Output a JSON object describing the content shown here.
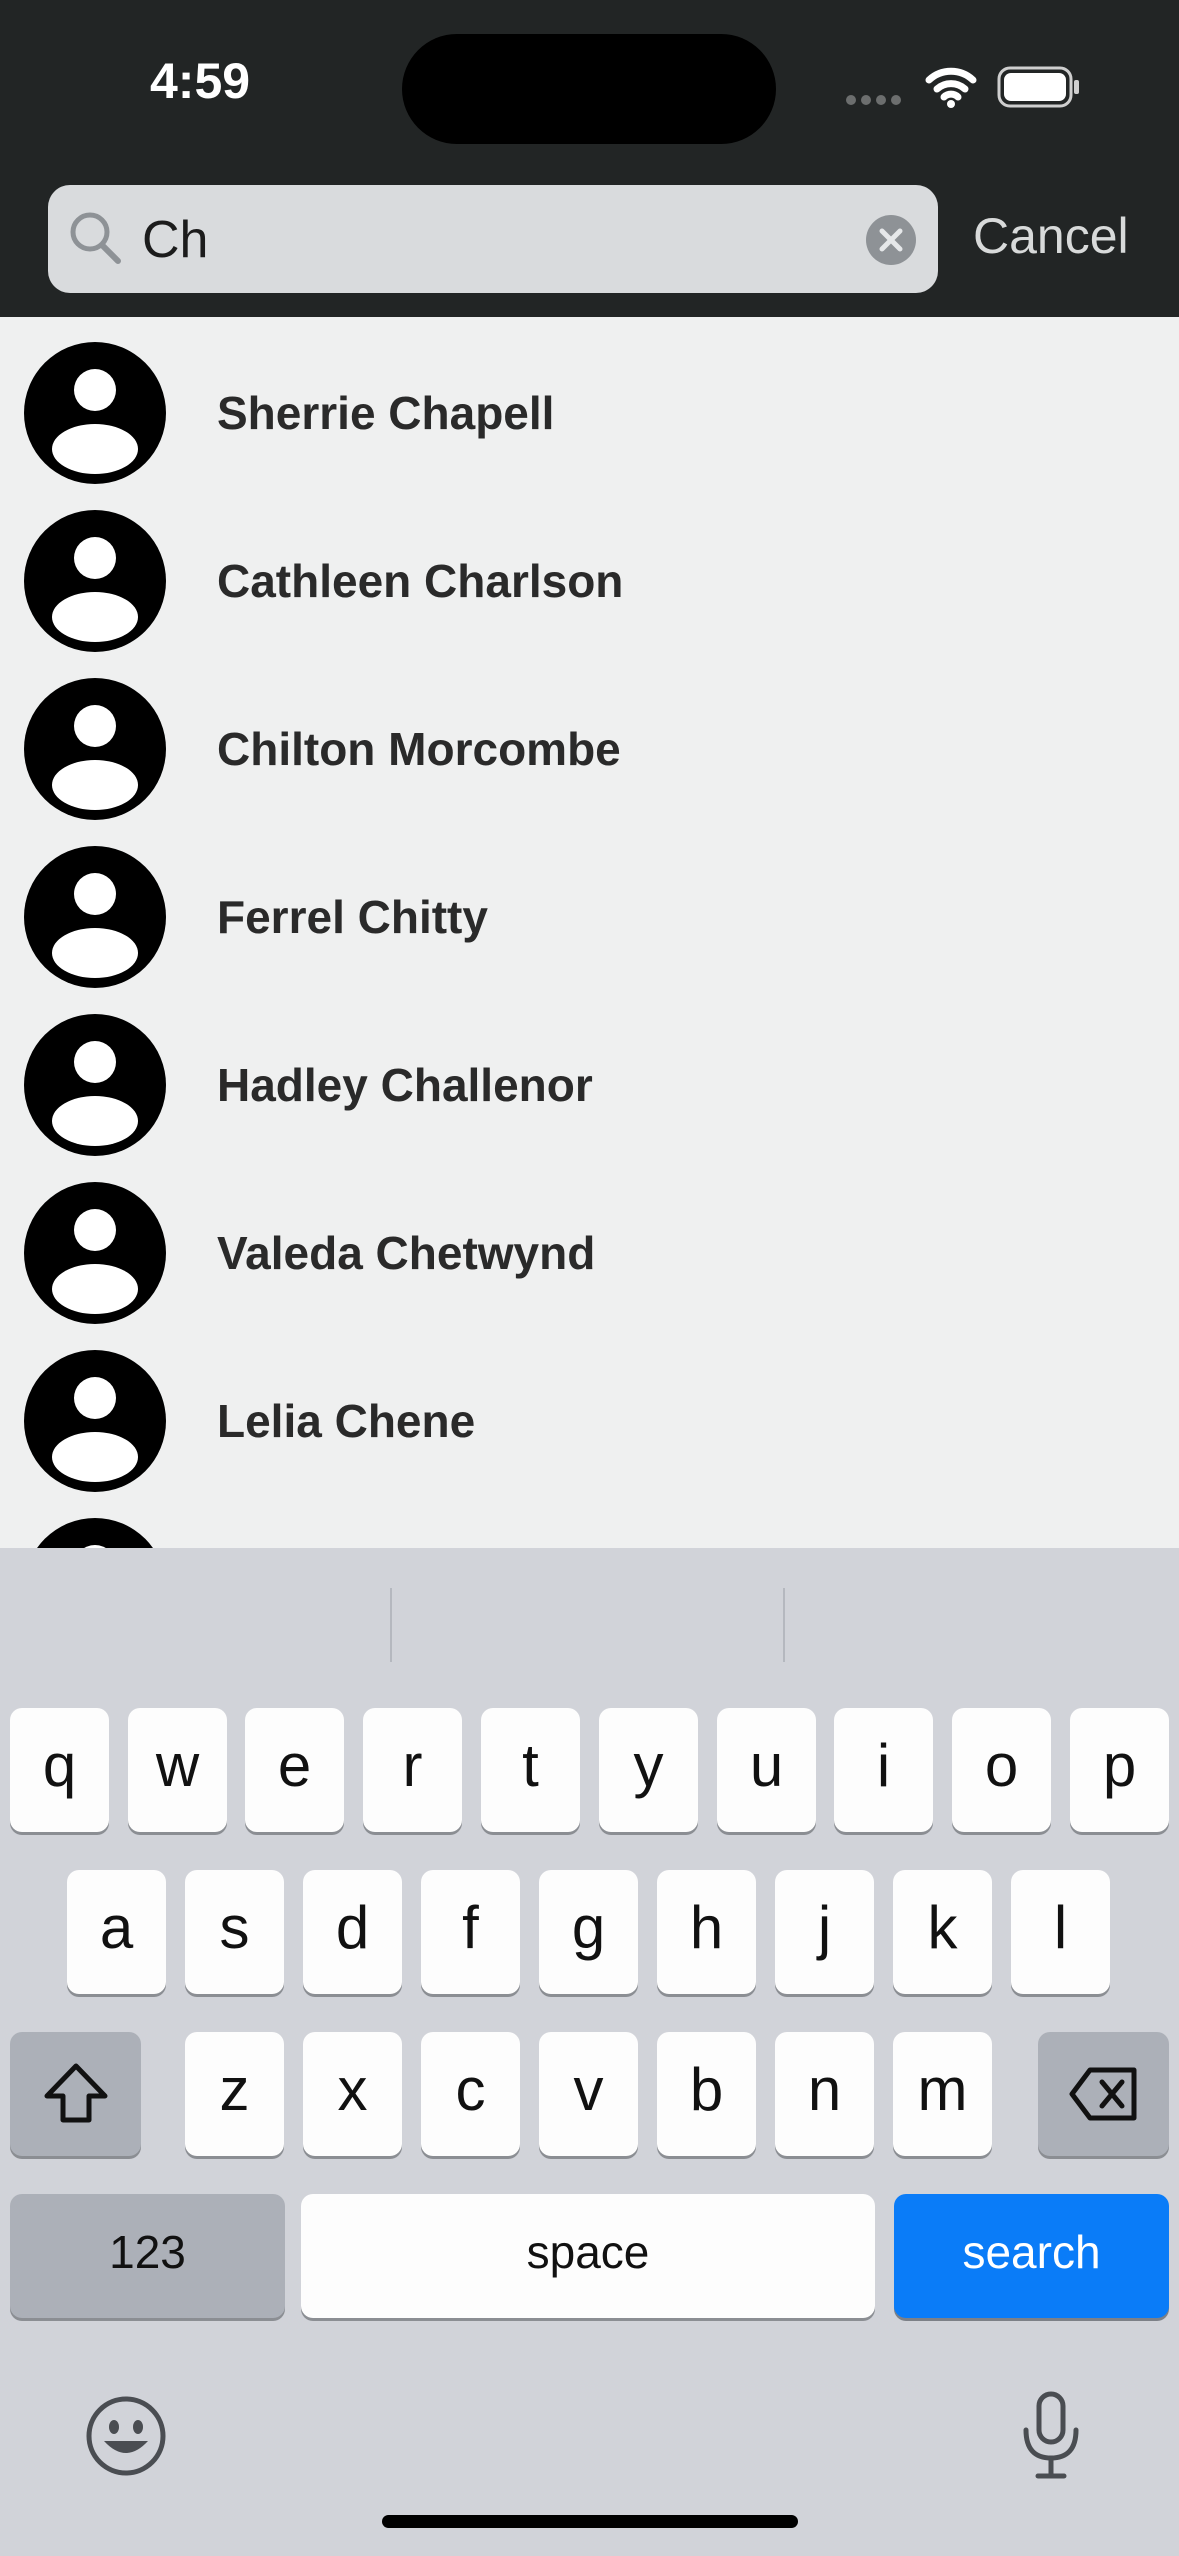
{
  "status_bar": {
    "time": "4:59"
  },
  "search": {
    "query": "Ch",
    "cancel_label": "Cancel"
  },
  "contacts": [
    {
      "name": "Sherrie Chapell"
    },
    {
      "name": "Cathleen Charlson"
    },
    {
      "name": "Chilton Morcombe"
    },
    {
      "name": "Ferrel Chitty"
    },
    {
      "name": "Hadley Challenor"
    },
    {
      "name": "Valeda Chetwynd"
    },
    {
      "name": "Lelia Chene"
    }
  ],
  "keyboard": {
    "row1": [
      "q",
      "w",
      "e",
      "r",
      "t",
      "y",
      "u",
      "i",
      "o",
      "p"
    ],
    "row2": [
      "a",
      "s",
      "d",
      "f",
      "g",
      "h",
      "j",
      "k",
      "l"
    ],
    "row3": [
      "z",
      "x",
      "c",
      "v",
      "b",
      "n",
      "m"
    ],
    "numbers_label": "123",
    "space_label": "space",
    "search_label": "search"
  },
  "colors": {
    "accent": "#0a7cf8",
    "header_bg": "#222525",
    "list_bg": "#eff0f0",
    "keyboard_bg": "#d1d3d9"
  },
  "icons": [
    "search-icon",
    "clear-icon",
    "wifi-icon",
    "battery-icon",
    "person-icon",
    "shift-icon",
    "delete-icon",
    "emoji-icon",
    "microphone-icon"
  ]
}
